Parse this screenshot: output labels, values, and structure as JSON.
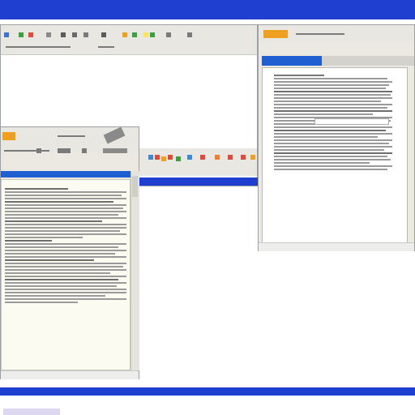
{
  "colors": {
    "taskbar_blue": "#1f3fd0",
    "window_chrome": "#e9e7e1",
    "title_blue": "#1f5fd1",
    "paper": "#fbfbf2",
    "text_gray": "#9a9a9a",
    "accent_orange": "#f0a020",
    "accent_green": "#3aa040",
    "accent_red": "#e04a3a"
  },
  "windows": {
    "top_left": {
      "title": ""
    },
    "right": {
      "title": ""
    },
    "left_document": {
      "title": ""
    }
  },
  "icons": [
    "app-icon",
    "toolbar-icon",
    "toolbar-icon",
    "toolbar-icon",
    "scroll-thumb-icon",
    "window-close-icon"
  ]
}
